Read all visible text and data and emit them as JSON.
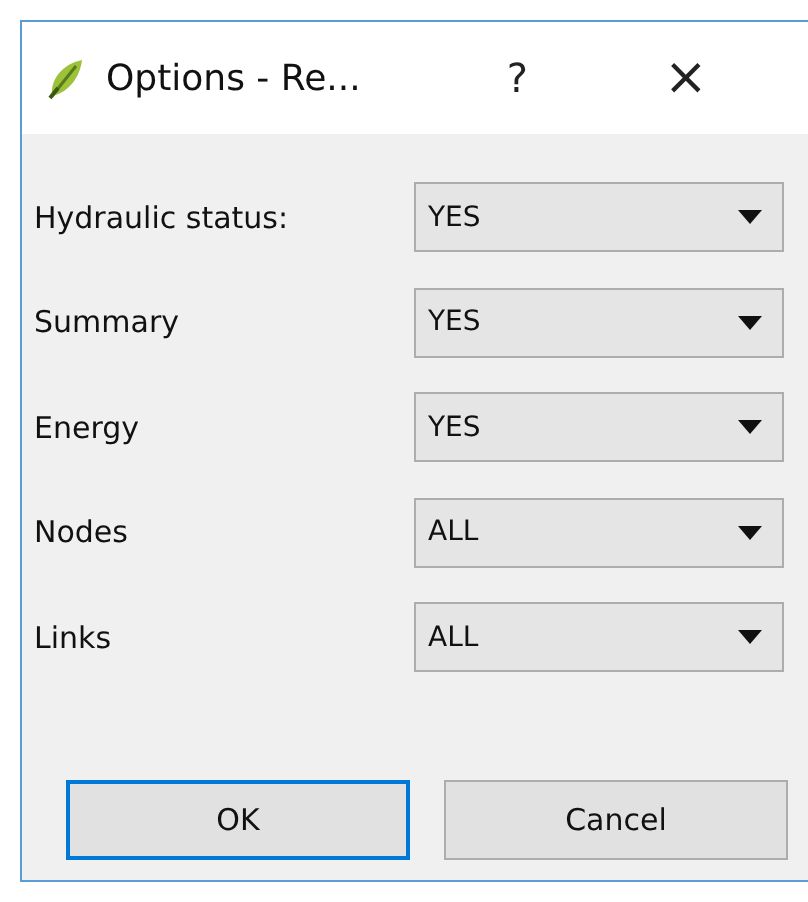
{
  "window": {
    "title": "Options - Re...",
    "help": "?",
    "close": "×"
  },
  "fields": [
    {
      "label": "Hydraulic status:",
      "value": "YES"
    },
    {
      "label": "Summary",
      "value": "YES"
    },
    {
      "label": "Energy",
      "value": "YES"
    },
    {
      "label": "Nodes",
      "value": "ALL"
    },
    {
      "label": "Links",
      "value": "ALL"
    }
  ],
  "buttons": [
    {
      "label": "OK",
      "default": true
    },
    {
      "label": "Cancel",
      "default": false
    }
  ]
}
